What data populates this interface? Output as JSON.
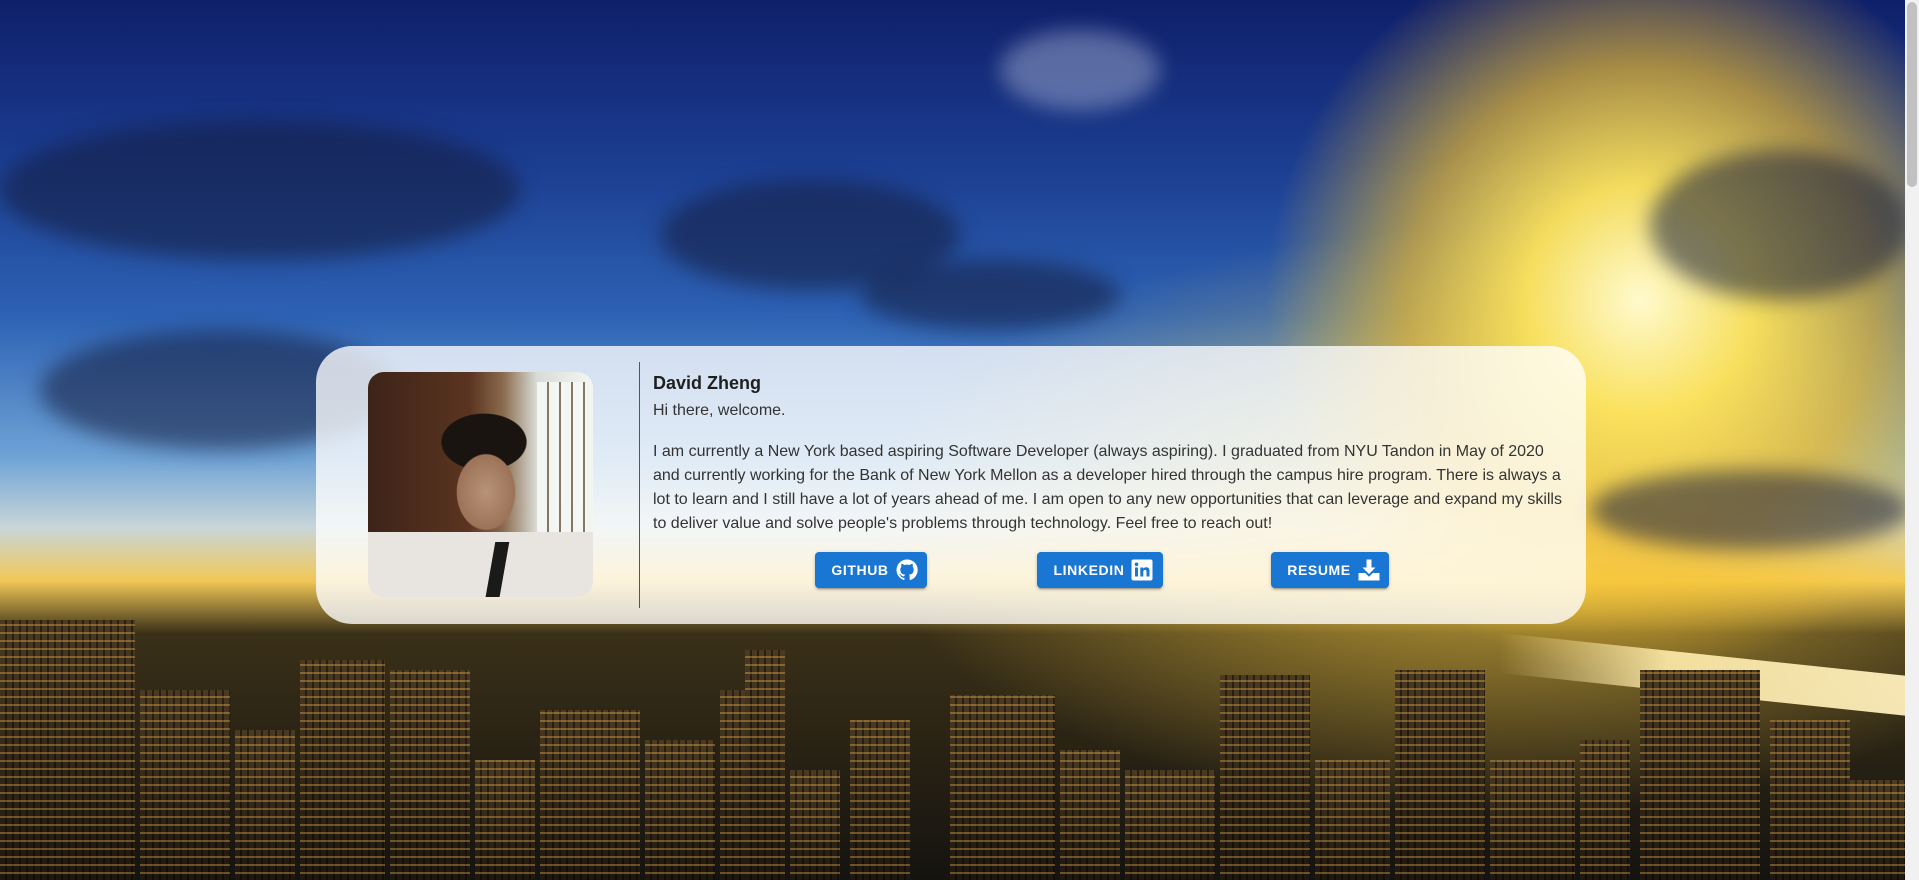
{
  "profile": {
    "name": "David Zheng",
    "greeting": "Hi there, welcome.",
    "bio": "I am currently a New York based aspiring Software Developer (always aspiring). I graduated from NYU Tandon in May of 2020 and currently working for the Bank of New York Mellon as a developer hired through the campus hire program. There is always a lot to learn and I still have a lot of years ahead of me. I am open to any new opportunities that can leverage and expand my skills to deliver value and solve people's problems through technology. Feel free to reach out!"
  },
  "links": {
    "github_label": "GITHUB",
    "github_icon": "github-icon",
    "linkedin_label": "LINKEDIN",
    "linkedin_icon": "linkedin-icon",
    "resume_label": "RESUME",
    "resume_icon": "download-icon"
  },
  "colors": {
    "button": "#1976d2",
    "card": "rgba(255,255,255,0.78)"
  }
}
